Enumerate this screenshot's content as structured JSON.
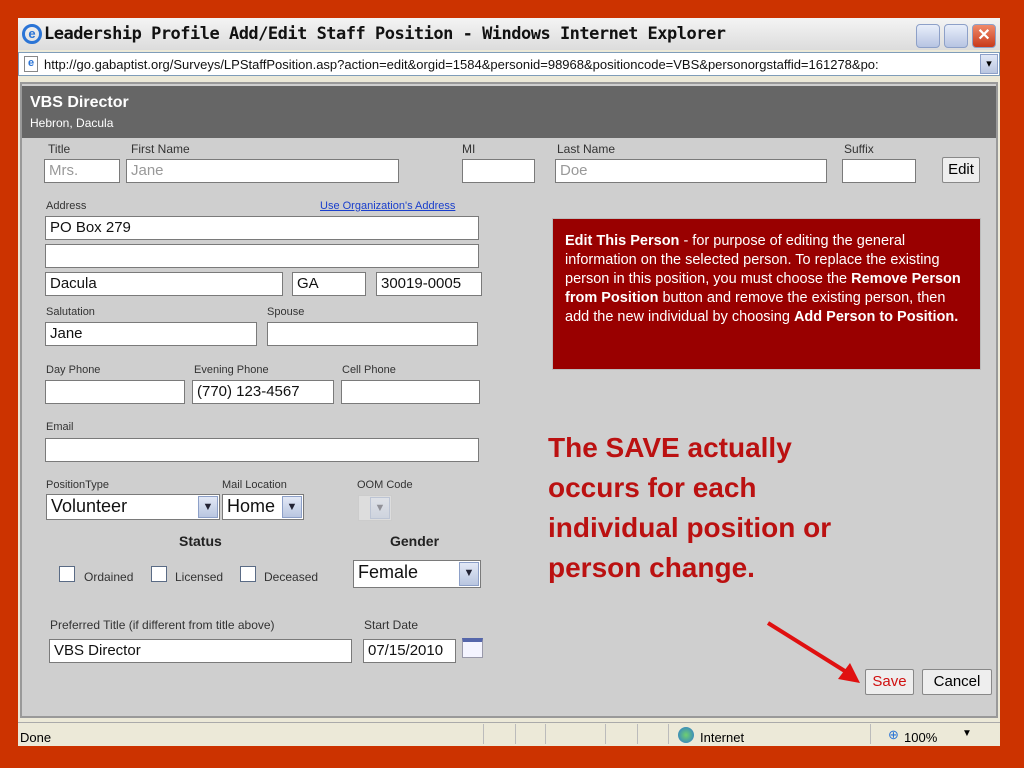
{
  "window": {
    "title": "Leadership Profile Add/Edit Staff Position - Windows Internet Explorer",
    "url": "http://go.gabaptist.org/Surveys/LPStaffPosition.asp?action=edit&orgid=1584&personid=98968&positioncode=VBS&personorgstaffid=161278&po:"
  },
  "header": {
    "title": "VBS Director",
    "subtitle": "Hebron, Dacula"
  },
  "name": {
    "title_label": "Title",
    "title_value": "Mrs.",
    "first_label": "First Name",
    "first_value": "Jane",
    "mi_label": "MI",
    "mi_value": "",
    "last_label": "Last Name",
    "last_value": "Doe",
    "suffix_label": "Suffix",
    "suffix_value": "",
    "edit_button": "Edit"
  },
  "address": {
    "label": "Address",
    "use_org_link": "Use Organization's Address",
    "line1": "PO Box 279",
    "line2": "",
    "city": "Dacula",
    "state": "GA",
    "zip": "30019-0005"
  },
  "salutation": {
    "label": "Salutation",
    "value": "Jane",
    "spouse_label": "Spouse",
    "spouse_value": ""
  },
  "phones": {
    "day_label": "Day Phone",
    "day_value": "",
    "evening_label": "Evening Phone",
    "evening_value": "(770) 123-4567",
    "cell_label": "Cell Phone",
    "cell_value": ""
  },
  "email": {
    "label": "Email",
    "value": ""
  },
  "position": {
    "type_label": "PositionType",
    "type_value": "Volunteer",
    "mail_label": "Mail Location",
    "mail_value": "Home",
    "oom_label": "OOM Code",
    "oom_value": ""
  },
  "status": {
    "label": "Status",
    "options": [
      "Ordained",
      "Licensed",
      "Deceased"
    ]
  },
  "gender": {
    "label": "Gender",
    "value": "Female"
  },
  "preferred": {
    "label": "Preferred Title (if different from title above)",
    "value": "VBS Director",
    "start_label": "Start Date",
    "start_value": "07/15/2010"
  },
  "note": {
    "b1": "Edit This Person",
    "t1": " - for purpose of editing the general information on the selected person. To replace the existing person in this position, you must choose the ",
    "b2": "Remove Person from Position",
    "t2": " button and remove the existing person, then add the new individual by choosing ",
    "b3": "Add Person to Position."
  },
  "callout": "The SAVE actually occurs for each individual position or person change.",
  "buttons": {
    "save": "Save",
    "cancel": "Cancel"
  },
  "statusbar": {
    "text": "Done",
    "zone": "Internet",
    "zoom": "100%"
  },
  "colors": {
    "background": "#cc3300",
    "note": "#990000",
    "callout": "#bb1111"
  }
}
